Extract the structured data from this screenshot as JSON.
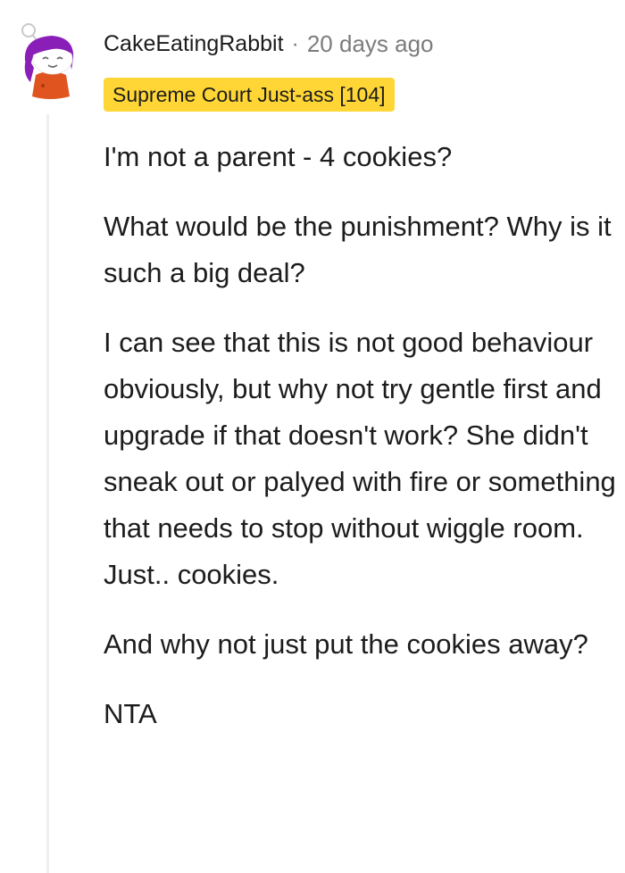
{
  "comment": {
    "username": "CakeEatingRabbit",
    "separator": "·",
    "timestamp": "20 days ago",
    "flair": "Supreme Court Just-ass [104]",
    "flair_color": "#ffd635",
    "avatar_icon": "snoo-avatar-purple-hair-orange-shirt",
    "paragraphs": [
      "I'm not a parent - 4 cookies?",
      "What would be the punishment? Why is it such a big deal?",
      "I can see that this is not good behaviour obviously, but why not try gentle first and upgrade if that doesn't work? She didn't sneak out or palyed with fire or something that needs to stop without wiggle room. Just.. cookies.",
      "And why not just put the cookies away?",
      "NTA"
    ]
  }
}
